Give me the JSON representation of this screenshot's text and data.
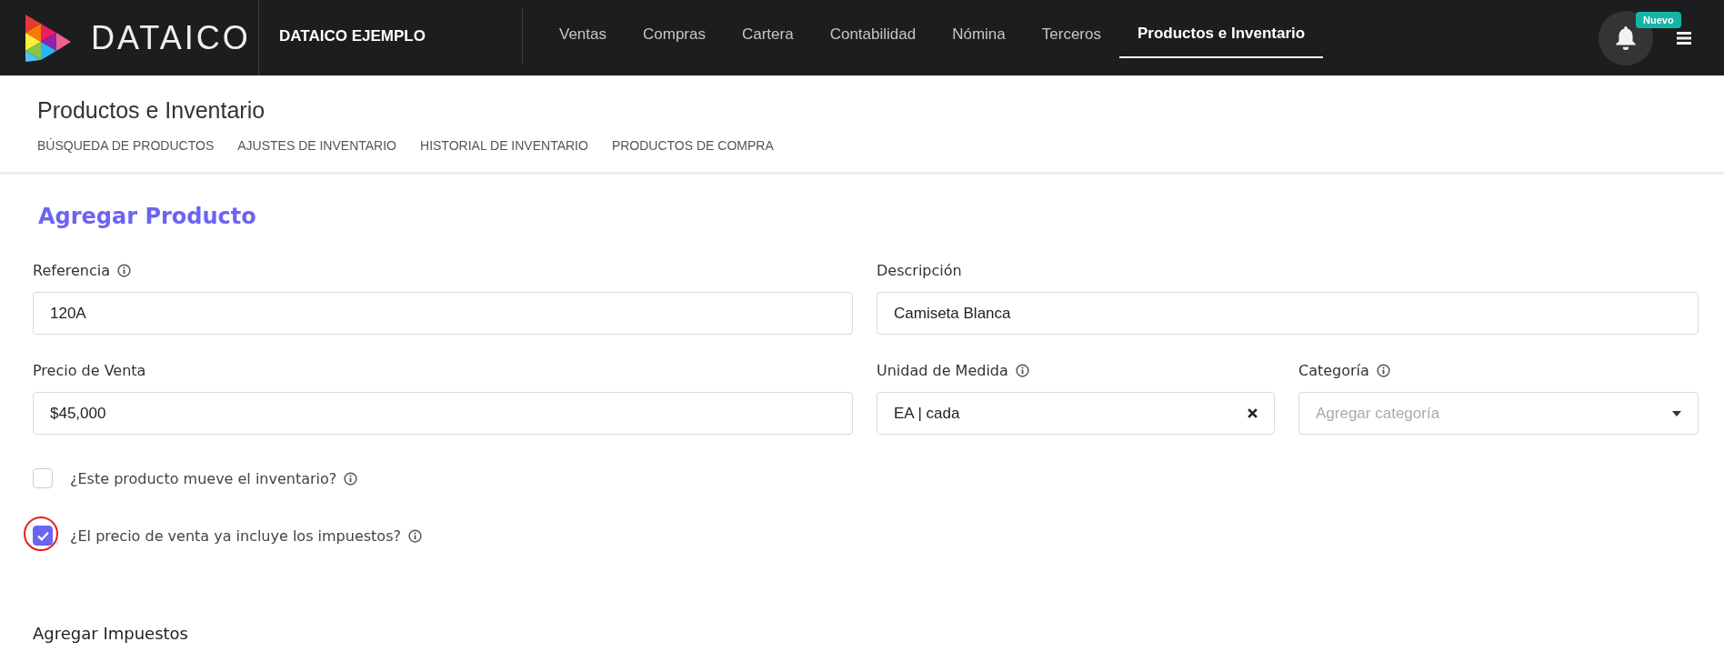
{
  "brand": {
    "name": "DATAICO"
  },
  "company": "DATAICO EJEMPLO",
  "nav": [
    {
      "label": "Ventas",
      "selected": false
    },
    {
      "label": "Compras",
      "selected": false
    },
    {
      "label": "Cartera",
      "selected": false
    },
    {
      "label": "Contabilidad",
      "selected": false
    },
    {
      "label": "Nómina",
      "selected": false
    },
    {
      "label": "Terceros",
      "selected": false
    },
    {
      "label": "Productos e Inventario",
      "selected": true
    }
  ],
  "notifications": {
    "badge": "Nuevo"
  },
  "page_title": "Productos e Inventario",
  "subtabs": [
    {
      "label": "BÚSQUEDA DE PRODUCTOS",
      "selected": false
    },
    {
      "label": "AJUSTES DE INVENTARIO",
      "selected": false
    },
    {
      "label": "HISTORIAL DE INVENTARIO",
      "selected": false
    },
    {
      "label": "PRODUCTOS DE COMPRA",
      "selected": false
    }
  ],
  "form": {
    "title": "Agregar Producto",
    "rows": [
      [
        {
          "kind": "text",
          "label": "Referencia",
          "info": true,
          "value": "120A"
        },
        {
          "kind": "text",
          "label": "Descripción",
          "info": false,
          "value": "Camiseta Blanca"
        }
      ],
      [
        {
          "kind": "text",
          "label": "Precio de Venta",
          "info": false,
          "value": "$45,000"
        },
        {
          "kind": "clearable",
          "label": "Unidad de Medida",
          "info": true,
          "value": "EA | cada"
        },
        {
          "kind": "dropdown",
          "label": "Categoría",
          "info": true,
          "placeholder": "Agregar categoría"
        }
      ]
    ],
    "checkboxes": [
      {
        "label": "¿Este producto mueve el inventario?",
        "checked": false,
        "highlighted": false
      },
      {
        "label": "¿El precio de venta ya incluye los impuestos?",
        "checked": true,
        "highlighted": true
      }
    ],
    "taxes_title": "Agregar Impuestos"
  }
}
